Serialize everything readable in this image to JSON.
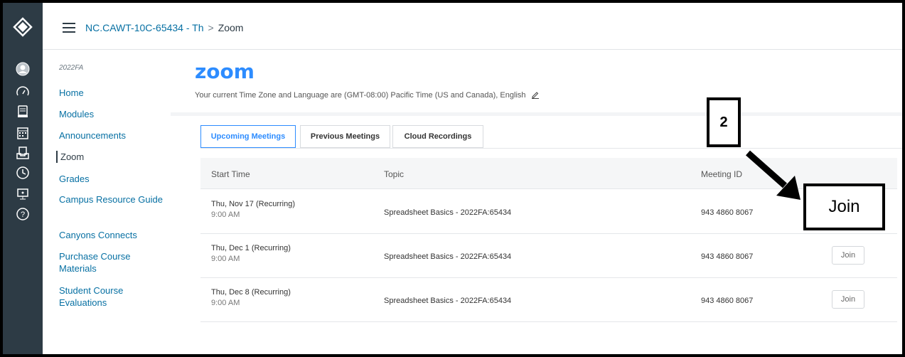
{
  "header": {
    "course": "NC.CAWT-10C-65434 - Th",
    "separator": ">",
    "page": "Zoom"
  },
  "global_nav": {
    "icons": [
      "canvas-logo-icon",
      "account-icon",
      "dashboard-icon",
      "courses-icon",
      "calendar-icon",
      "inbox-icon",
      "history-icon",
      "commons-icon",
      "help-icon"
    ]
  },
  "course_nav": {
    "term": "2022FA",
    "items": [
      {
        "label": "Home"
      },
      {
        "label": "Modules"
      },
      {
        "label": "Announcements"
      },
      {
        "label": "Zoom",
        "active": true
      },
      {
        "label": "Grades"
      },
      {
        "label": "Campus Resource Guide"
      },
      {
        "label": "Canyons Connects"
      },
      {
        "label": "Purchase Course Materials"
      },
      {
        "label": "Student Course Evaluations"
      }
    ]
  },
  "zoom": {
    "logo": "zoom",
    "timezone_text": "Your current Time Zone and Language are (GMT-08:00) Pacific Time (US and Canada), English",
    "tabs": [
      "Upcoming Meetings",
      "Previous Meetings",
      "Cloud Recordings"
    ],
    "active_tab": "Upcoming Meetings",
    "columns": [
      "Start Time",
      "Topic",
      "Meeting ID"
    ],
    "meetings": [
      {
        "date": "Thu, Nov 17 (Recurring)",
        "time": "9:00 AM",
        "topic": "Spreadsheet Basics - 2022FA:65434",
        "id": "943 4860 8067",
        "join": "Join"
      },
      {
        "date": "Thu, Dec 1 (Recurring)",
        "time": "9:00 AM",
        "topic": "Spreadsheet Basics - 2022FA:65434",
        "id": "943 4860 8067",
        "join": "Join"
      },
      {
        "date": "Thu, Dec 8 (Recurring)",
        "time": "9:00 AM",
        "topic": "Spreadsheet Basics - 2022FA:65434",
        "id": "943 4860 8067",
        "join": "Join"
      }
    ]
  },
  "annotation": {
    "step": "2",
    "callout": "Join"
  },
  "colors": {
    "nav_bg": "#2d3b45",
    "link": "#0770a3",
    "zoom_blue": "#2d8cff"
  }
}
